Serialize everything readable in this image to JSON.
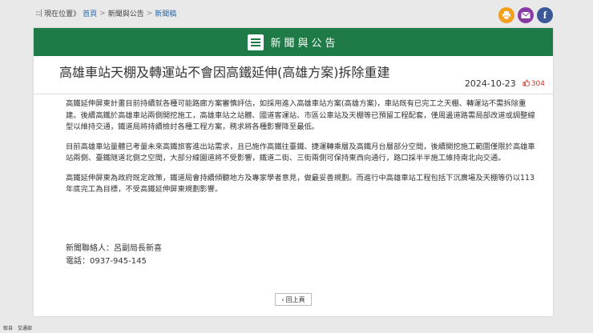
{
  "breadcrumb": {
    "dots": ":::|",
    "prefix": "現在位置》",
    "items": [
      "首頁",
      "新聞與公告",
      "新聞稿"
    ],
    "separator": ">"
  },
  "top_icons": [
    "print-icon",
    "mail-icon",
    "facebook-icon"
  ],
  "header": {
    "title": "新聞與公告",
    "icon": "news-icon"
  },
  "article": {
    "title": "高雄車站天棚及轉運站不會因高鐵延伸(高雄方案)拆除重建",
    "date": "2024-10-23",
    "likes": "304",
    "paragraphs": [
      "高鐵延伸屏東計畫目前持續就各種可能路廊方案審慎評估，如採用進入高雄車站方案(高雄方案)，車站既有已完工之天棚、轉運站不需拆除重建。後續高鐵於高雄車站兩側開挖施工，高雄車站之站體、國道客運站、市區公車站及天棚等已預留工程配套，僅周邊道路需局部改道或調整線型以維持交通，鐵道局將持續檢討各種工程方案，務求將各種影響降至最低。",
      "目前高雄車站量體已考量未來高鐵旅客進出站需求，且已施作高鐵往臺鐵、捷運轉乘層及高鐵月台層部分空間，後續開挖施工範圍僅限於高雄車站兩側、臺鐵隧道北側之空間，大部分線園道將不受影響，鐵道二街、三街兩側可保持東西向通行，路口採半半施工維持南北向交通。",
      "高鐵延伸屏東為政府既定政策，鐵道局會持續傾聽地方及專家學者意見，做最妥善規劃。而進行中高雄車站工程包括下沉廣場及天棚等仍以113年底完工為目標，不受高鐵延伸屏東規劃影響。"
    ],
    "contact_person": "新聞聯絡人：呂副局長新喜",
    "contact_phone": "電話：0937-945-145"
  },
  "back_button": {
    "label": "回上頁",
    "icon": "chevron-left-icon"
  },
  "footer_status": "取自　交通部",
  "colors": {
    "header_green": "#1e7a46",
    "link_blue": "#2a6ab0",
    "likes_red": "#c0392b"
  }
}
